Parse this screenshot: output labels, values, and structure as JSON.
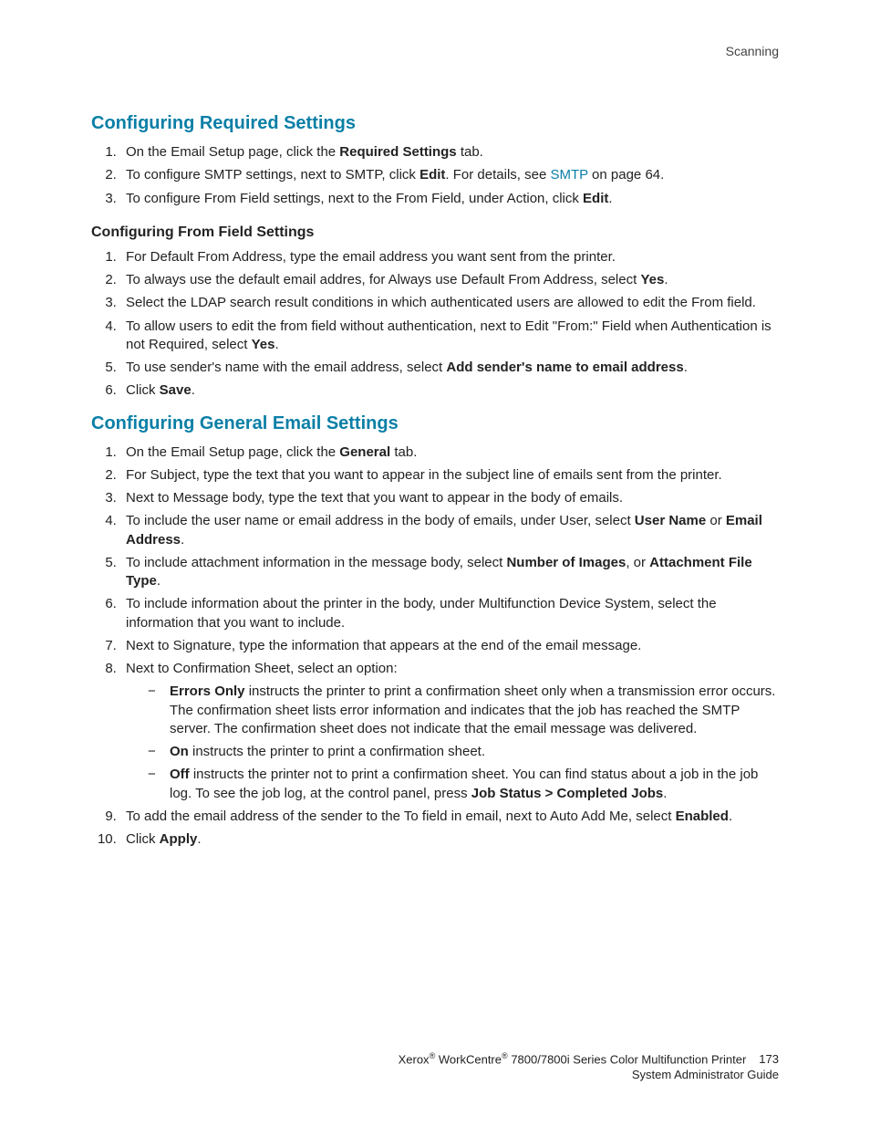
{
  "header": {
    "section_label": "Scanning"
  },
  "section1": {
    "title": "Configuring Required Settings",
    "steps": [
      {
        "pre": "On the Email Setup page, click the ",
        "bold": "Required Settings",
        "post": " tab."
      },
      {
        "pre": "To configure SMTP settings, next to SMTP, click ",
        "bold": "Edit",
        "post_a": ". For details, see ",
        "link": "SMTP",
        "post_b": " on page 64."
      },
      {
        "pre": "To configure From Field settings, next to the From Field, under Action, click ",
        "bold": "Edit",
        "post": "."
      }
    ],
    "sub": {
      "title": "Configuring From Field Settings",
      "steps": [
        {
          "text": "For Default From Address, type the email address you want sent from the printer."
        },
        {
          "pre": "To always use the default email addres, for Always use Default From Address, select ",
          "bold": "Yes",
          "post": "."
        },
        {
          "text": "Select the LDAP search result conditions in which authenticated users are allowed to edit the From field."
        },
        {
          "pre": "To allow users to edit the from field without authentication, next to Edit \"From:\" Field when Authentication is not Required, select ",
          "bold": "Yes",
          "post": "."
        },
        {
          "pre": "To use sender's name with the email address, select ",
          "bold": "Add sender's name to email address",
          "post": "."
        },
        {
          "pre": "Click ",
          "bold": "Save",
          "post": "."
        }
      ]
    }
  },
  "section2": {
    "title": "Configuring General Email Settings",
    "steps": [
      {
        "pre": "On the Email Setup page, click the ",
        "bold": "General",
        "post": " tab."
      },
      {
        "text": "For Subject, type the text that you want to appear in the subject line of emails sent from the printer."
      },
      {
        "text": "Next to Message body, type the text that you want to appear in the body of emails."
      },
      {
        "pre": "To include the user name or email address in the body of emails, under User, select ",
        "bold": "User Name",
        "mid": " or ",
        "bold2": "Email Address",
        "post": "."
      },
      {
        "pre": "To include attachment information in the message body, select ",
        "bold": "Number of Images",
        "mid": ", or ",
        "bold2": "Attachment File Type",
        "post": "."
      },
      {
        "text": "To include information about the printer in the body, under Multifunction Device System, select the information that you want to include."
      },
      {
        "text": "Next to Signature, type the information that appears at the end of the email message."
      },
      {
        "text": "Next to Confirmation Sheet, select an option:",
        "sub": [
          {
            "bold": "Errors Only",
            "post": " instructs the printer to print a confirmation sheet only when a transmission error occurs. The confirmation sheet lists error information and indicates that the job has reached the SMTP server. The confirmation sheet does not indicate that the email message was delivered."
          },
          {
            "bold": "On",
            "post": " instructs the printer to print a confirmation sheet."
          },
          {
            "bold": "Off",
            "post": " instructs the printer not to print a confirmation sheet. You can find status about a job in the job log. To see the job log, at the control panel, press ",
            "bold2": "Job Status > Completed Jobs",
            "post2": "."
          }
        ]
      },
      {
        "pre": "To add the email address of the sender to the To field in email, next to Auto Add Me, select ",
        "bold": "Enabled",
        "post": "."
      },
      {
        "pre": "Click ",
        "bold": "Apply",
        "post": "."
      }
    ]
  },
  "footer": {
    "line1_a": "Xerox",
    "line1_b": " WorkCentre",
    "line1_c": " 7800/7800i Series Color Multifunction Printer",
    "page_number": "173",
    "line2": "System Administrator Guide"
  }
}
